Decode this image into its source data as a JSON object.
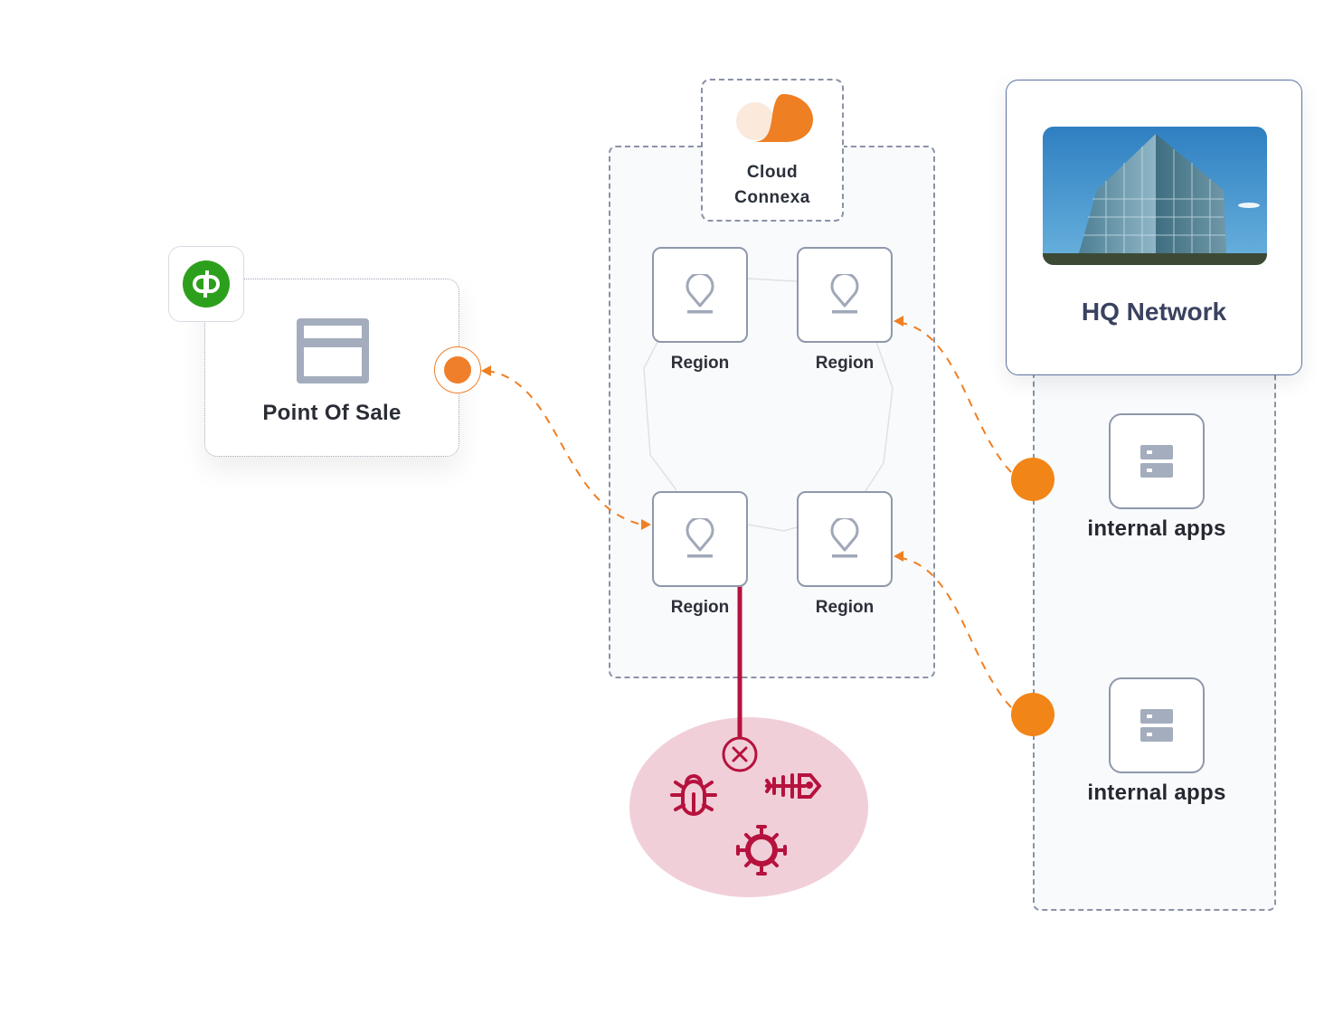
{
  "cloud": {
    "title": "Cloud\nConnexa",
    "logo_icon": "cloud-connexa-logo",
    "brand_color": "#ef7f23",
    "regions": [
      {
        "label": "Region",
        "icon": "map-pin-icon"
      },
      {
        "label": "Region",
        "icon": "map-pin-icon"
      },
      {
        "label": "Region",
        "icon": "map-pin-icon"
      },
      {
        "label": "Region",
        "icon": "map-pin-icon"
      }
    ]
  },
  "point_of_sale": {
    "title": "Point Of Sale",
    "icon": "window-icon",
    "badge_icon": "quickbooks-logo",
    "badge_color": "#2ca01c"
  },
  "hq": {
    "title": "HQ Network",
    "photo": "office-building-photo",
    "apps": [
      {
        "label": "internal apps",
        "icon": "server-icon"
      },
      {
        "label": "internal apps",
        "icon": "server-icon"
      }
    ]
  },
  "threats": {
    "icons": [
      "blocked-icon",
      "bug-icon",
      "phishing-fish-icon",
      "virus-icon"
    ],
    "color": "#b5123d",
    "zone_color": "#f1cfd9"
  },
  "connections": {
    "color": "#ef7f23",
    "style": "dashed"
  }
}
